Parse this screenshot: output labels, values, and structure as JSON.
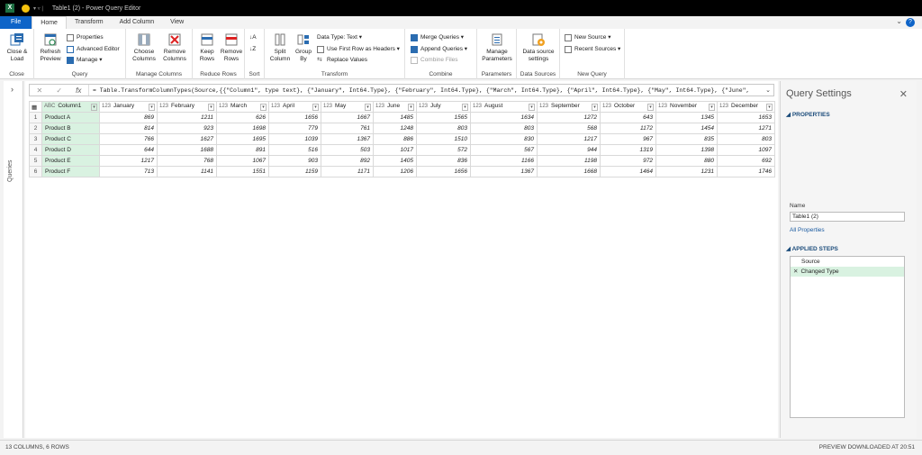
{
  "window": {
    "title": "Table1 (2) - Power Query Editor",
    "app_badge": "X"
  },
  "tabs": [
    "File",
    "Home",
    "Transform",
    "Add Column",
    "View"
  ],
  "ribbon": {
    "close": {
      "close_load": "Close &",
      "close_load2": "Load",
      "label": "Close"
    },
    "query": {
      "refresh": "Refresh",
      "refresh2": "Preview",
      "properties": "Properties",
      "advanced_editor": "Advanced Editor",
      "manage": "Manage",
      "label": "Query"
    },
    "manage_columns": {
      "choose": "Choose",
      "choose2": "Columns",
      "remove": "Remove",
      "remove2": "Columns",
      "label": "Manage Columns"
    },
    "reduce_rows": {
      "keep": "Keep",
      "keep2": "Rows",
      "remove": "Remove",
      "remove2": "Rows",
      "label": "Reduce Rows"
    },
    "sort": {
      "label": "Sort"
    },
    "transform": {
      "split": "Split",
      "split2": "Column",
      "group": "Group",
      "group2": "By",
      "data_type": "Data Type: Text",
      "first_row": "Use First Row as Headers",
      "replace": "Replace Values",
      "label": "Transform"
    },
    "combine": {
      "merge": "Merge Queries",
      "append": "Append Queries",
      "combine_files": "Combine Files",
      "label": "Combine"
    },
    "parameters": {
      "manage": "Manage",
      "manage2": "Parameters",
      "label": "Parameters"
    },
    "data_sources": {
      "settings": "Data source",
      "settings2": "settings",
      "label": "Data Sources"
    },
    "new_query": {
      "new_source": "New Source",
      "recent_sources": "Recent Sources",
      "label": "New Query"
    }
  },
  "queries_pane": {
    "label": "Queries"
  },
  "formula": "= Table.TransformColumnTypes(Source,{{\"Column1\", type text}, {\"January\", Int64.Type}, {\"February\", Int64.Type}, {\"March\", Int64.Type}, {\"April\", Int64.Type}, {\"May\", Int64.Type}, {\"June\",",
  "table": {
    "columns": [
      {
        "type": "ABC",
        "name": "Column1"
      },
      {
        "type": "123",
        "name": "January"
      },
      {
        "type": "123",
        "name": "February"
      },
      {
        "type": "123",
        "name": "March"
      },
      {
        "type": "123",
        "name": "April"
      },
      {
        "type": "123",
        "name": "May"
      },
      {
        "type": "123",
        "name": "June"
      },
      {
        "type": "123",
        "name": "July"
      },
      {
        "type": "123",
        "name": "August"
      },
      {
        "type": "123",
        "name": "September"
      },
      {
        "type": "123",
        "name": "October"
      },
      {
        "type": "123",
        "name": "November"
      },
      {
        "type": "123",
        "name": "December"
      }
    ],
    "rows": [
      [
        "Product A",
        "869",
        "1211",
        "626",
        "1656",
        "1667",
        "1485",
        "1565",
        "1634",
        "1272",
        "643",
        "1345",
        "1653"
      ],
      [
        "Product B",
        "814",
        "923",
        "1698",
        "779",
        "761",
        "1248",
        "803",
        "803",
        "568",
        "1172",
        "1454",
        "1271"
      ],
      [
        "Product C",
        "766",
        "1627",
        "1695",
        "1039",
        "1367",
        "886",
        "1510",
        "830",
        "1217",
        "967",
        "835",
        "803"
      ],
      [
        "Product D",
        "644",
        "1688",
        "891",
        "516",
        "503",
        "1017",
        "572",
        "567",
        "944",
        "1319",
        "1398",
        "1097"
      ],
      [
        "Product E",
        "1217",
        "768",
        "1067",
        "903",
        "892",
        "1405",
        "836",
        "1166",
        "1198",
        "972",
        "880",
        "692"
      ],
      [
        "Product F",
        "713",
        "1141",
        "1551",
        "1159",
        "1171",
        "1206",
        "1656",
        "1367",
        "1668",
        "1464",
        "1231",
        "1746"
      ]
    ]
  },
  "settings": {
    "title": "Query Settings",
    "properties_heading": "PROPERTIES",
    "name_label": "Name",
    "name_value": "Table1 (2)",
    "all_properties": "All Properties",
    "steps_heading": "APPLIED STEPS",
    "steps": [
      "Source",
      "Changed Type"
    ]
  },
  "status": {
    "left": "13 COLUMNS, 6 ROWS",
    "right": "PREVIEW DOWNLOADED AT 20:51"
  },
  "colors": {
    "accent": "#0e64c8",
    "selected_col": "#d9f2e1",
    "settings_heading": "#1a4b7a"
  }
}
